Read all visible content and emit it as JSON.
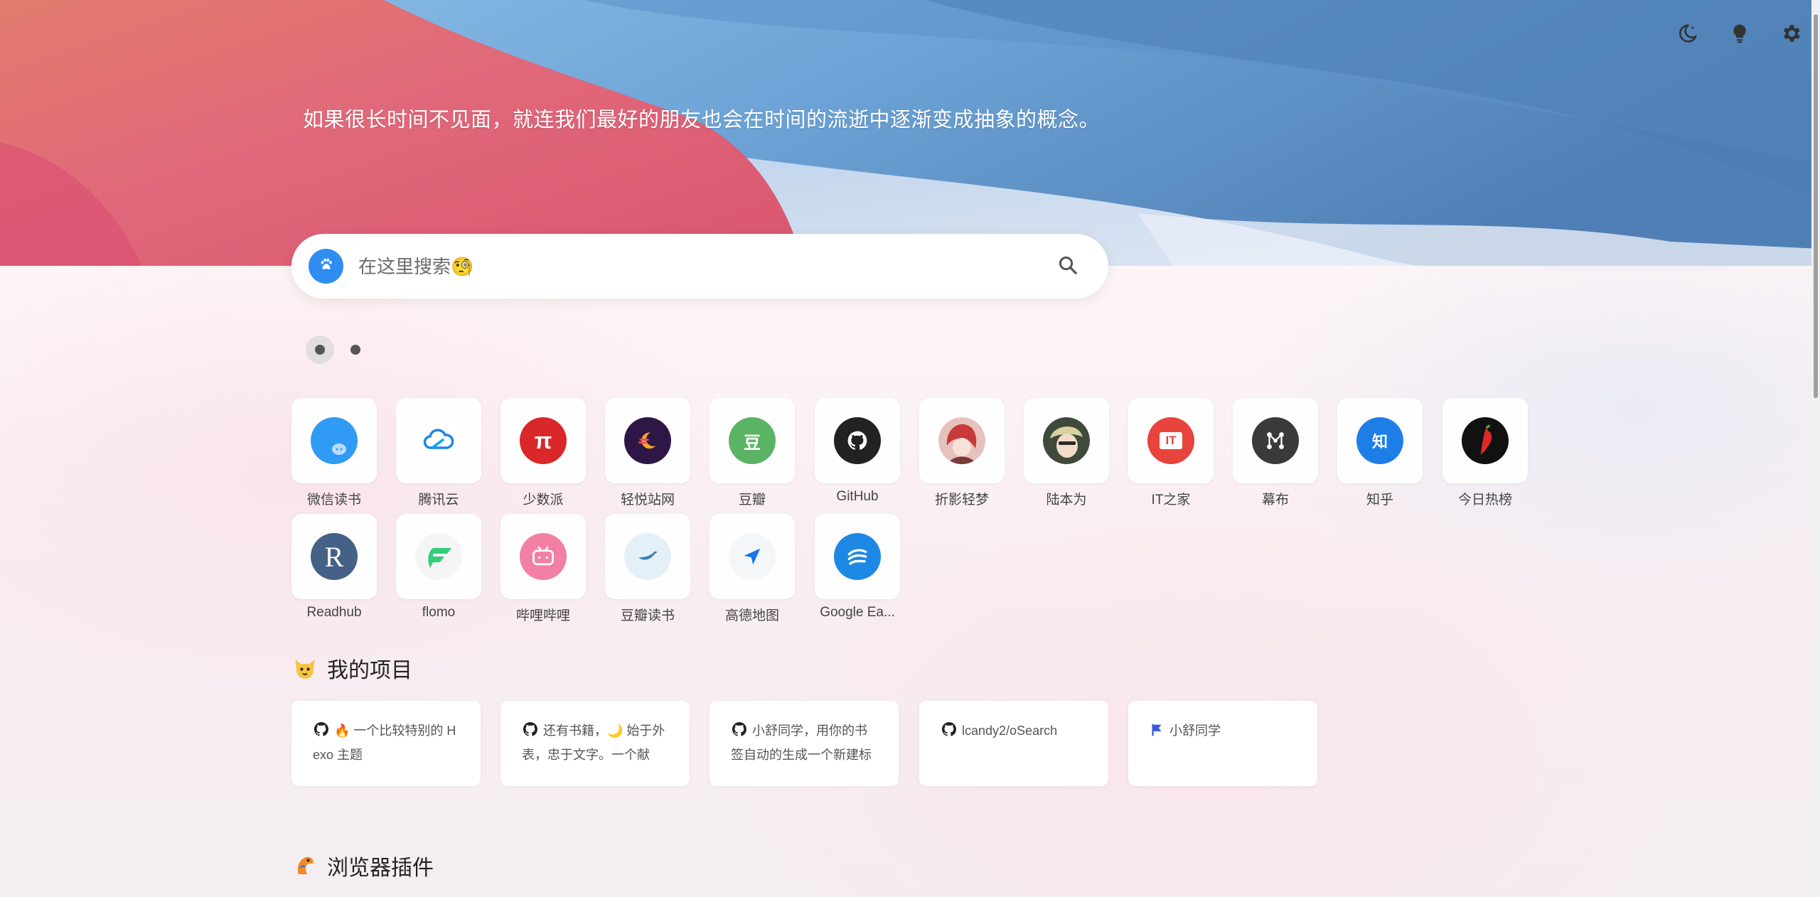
{
  "header": {
    "quote": "如果很长时间不见面，就连我们最好的朋友也会在时间的流逝中逐渐变成抽象的概念。",
    "icons": [
      "moon-icon",
      "lightbulb-icon",
      "gear-icon"
    ]
  },
  "search": {
    "placeholder": "在这里搜索🧐",
    "engine_icon": "paw-icon",
    "button_icon": "search-icon"
  },
  "pagination": {
    "pages": 2,
    "current": 1
  },
  "sites": [
    {
      "label": "微信读书",
      "icon": "weread-icon",
      "color": "#2f9bf5"
    },
    {
      "label": "腾讯云",
      "icon": "tencent-cloud-icon",
      "color": "#ffffff"
    },
    {
      "label": "少数派",
      "icon": "sspai-icon",
      "color": "#da282a",
      "glyph": "π"
    },
    {
      "label": "轻悦站网",
      "icon": "moon-logo-icon",
      "color": "#2e1747"
    },
    {
      "label": "豆瓣",
      "icon": "douban-icon",
      "color": "#5bb464",
      "glyph": "豆"
    },
    {
      "label": "GitHub",
      "icon": "github-icon",
      "color": "#222222"
    },
    {
      "label": "折影轻梦",
      "icon": "avatar-icon",
      "color": "#c94a4a"
    },
    {
      "label": "陆本为",
      "icon": "avatar-icon",
      "color": "#9aa591"
    },
    {
      "label": "IT之家",
      "icon": "ithome-icon",
      "color": "#e8433c",
      "glyph": "IT"
    },
    {
      "label": "幕布",
      "icon": "mubu-icon",
      "color": "#3a3a3a"
    },
    {
      "label": "知乎",
      "icon": "zhihu-icon",
      "color": "#1e7ee8",
      "glyph": "知"
    },
    {
      "label": "今日热榜",
      "icon": "pepper-icon",
      "color": "#111111"
    },
    {
      "label": "Readhub",
      "icon": "readhub-icon",
      "color": "#456187",
      "glyph": "R"
    },
    {
      "label": "flomo",
      "icon": "flomo-icon",
      "color": "#f5f5f5"
    },
    {
      "label": "哔哩哔哩",
      "icon": "bilibili-icon",
      "color": "#f27fa4"
    },
    {
      "label": "豆瓣读书",
      "icon": "bird-icon",
      "color": "#e4f0f7"
    },
    {
      "label": "高德地图",
      "icon": "navigation-icon",
      "color": "#f4f6f8"
    },
    {
      "label": "Google Ea...",
      "icon": "google-earth-icon",
      "color": "#1e88e5"
    }
  ],
  "sections": {
    "projects_title": "我的项目",
    "plugins_title": "浏览器插件"
  },
  "projects": [
    {
      "text": "🔥 一个比较特别的 Hexo 主题",
      "icon": "github-icon"
    },
    {
      "text": "还有书籍，🌙 始于外表，忠于文字。一个献",
      "icon": "github-icon"
    },
    {
      "text": "小舒同学，用你的书签自动的生成一个新建标",
      "icon": "github-icon"
    },
    {
      "text": "lcandy2/oSearch",
      "icon": "github-icon"
    },
    {
      "text": "小舒同学",
      "icon": "flag-icon"
    }
  ]
}
